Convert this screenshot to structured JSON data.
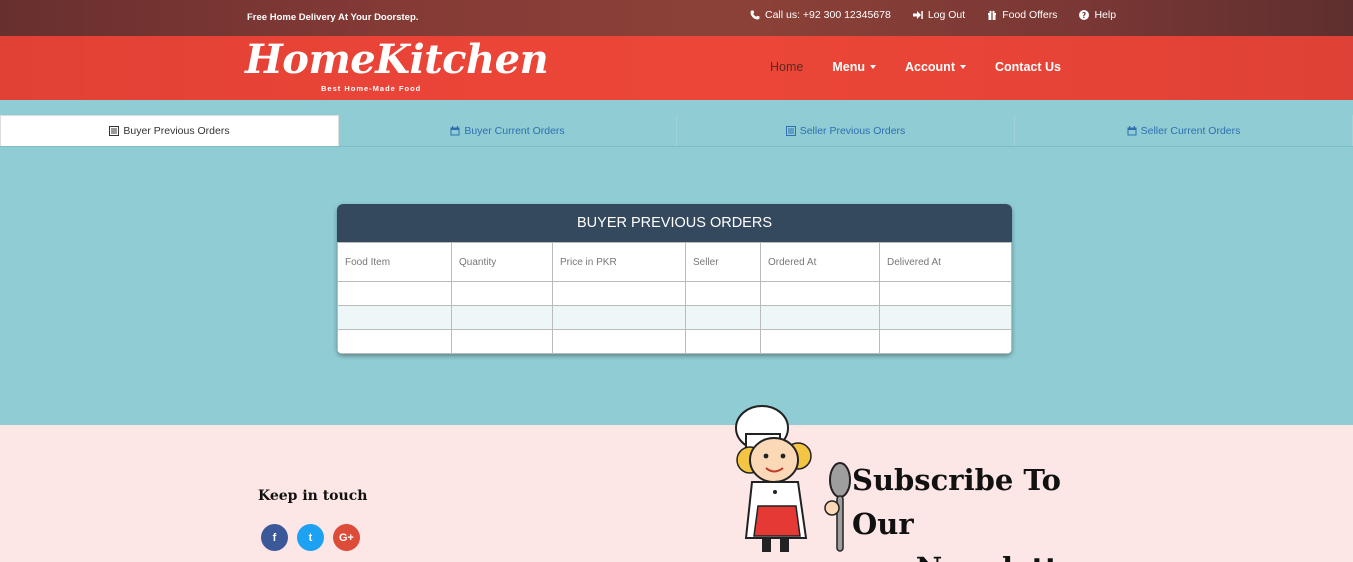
{
  "topbar": {
    "tagline": "Free Home Delivery At Your Doorstep.",
    "links": [
      {
        "icon": "phone-icon",
        "label": "Call us: +92 300 12345678"
      },
      {
        "icon": "logout-icon",
        "label": "Log Out"
      },
      {
        "icon": "gift-icon",
        "label": "Food Offers"
      },
      {
        "icon": "help-icon",
        "label": "Help"
      }
    ]
  },
  "brand": {
    "name": "HomeKitchen",
    "tagline": "Best Home-Made Food"
  },
  "nav": {
    "home": "Home",
    "menu": "Menu",
    "account": "Account",
    "contact": "Contact Us"
  },
  "tabs": [
    {
      "icon": "list-icon",
      "label": "Buyer Previous Orders",
      "active": true
    },
    {
      "icon": "calendar-icon",
      "label": "Buyer Current Orders",
      "active": false
    },
    {
      "icon": "list-icon",
      "label": "Seller Previous Orders",
      "active": false
    },
    {
      "icon": "calendar-icon",
      "label": "Seller Current Orders",
      "active": false
    }
  ],
  "orders": {
    "title": "BUYER PREVIOUS ORDERS",
    "columns": [
      "Food Item",
      "Quantity",
      "Price in PKR",
      "Seller",
      "Ordered At",
      "Delivered At"
    ]
  },
  "footer": {
    "keep_in_touch": "Keep in touch",
    "social": [
      {
        "icon": "facebook-icon",
        "glyph": "f",
        "color": "#3b5998"
      },
      {
        "icon": "twitter-icon",
        "glyph": "t",
        "color": "#1da1f2"
      },
      {
        "icon": "google-plus-icon",
        "glyph": "G+",
        "color": "#dd4b39"
      }
    ],
    "subscribe_line1": "Subscribe To Our",
    "subscribe_line2": "Newsletter"
  },
  "colors": {
    "accent": "#f44336",
    "band": "#8fccd3",
    "panel_header": "#34495e",
    "footer": "#fde6e6"
  }
}
